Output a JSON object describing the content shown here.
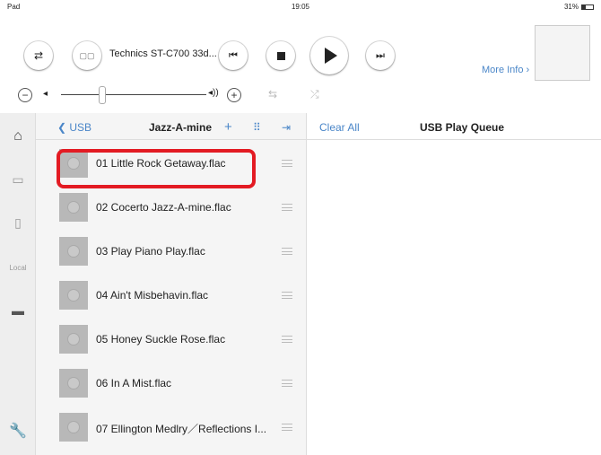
{
  "status": {
    "device": "Pad",
    "time": "19:05",
    "battery": "31%"
  },
  "player": {
    "model": "Technics ST-C700 33d...",
    "more_info": "More Info",
    "album_art_present": true
  },
  "browser": {
    "back_label": "USB",
    "title": "Jazz-A-mine",
    "tracks": [
      "01 Little Rock Getaway.flac",
      "02 Cocerto Jazz-A-mine.flac",
      "03 Play Piano Play.flac",
      "04 Ain't Misbehavin.flac",
      "05 Honey Suckle Rose.flac",
      "06 In A Mist.flac",
      "07 Ellington Medlry／Reflections I..."
    ]
  },
  "queue": {
    "clear_label": "Clear All",
    "title": "USB Play Queue"
  },
  "sidebar": {
    "local_label": "Local"
  },
  "colors": {
    "accent": "#4a86c8",
    "highlight": "#e31b23"
  }
}
